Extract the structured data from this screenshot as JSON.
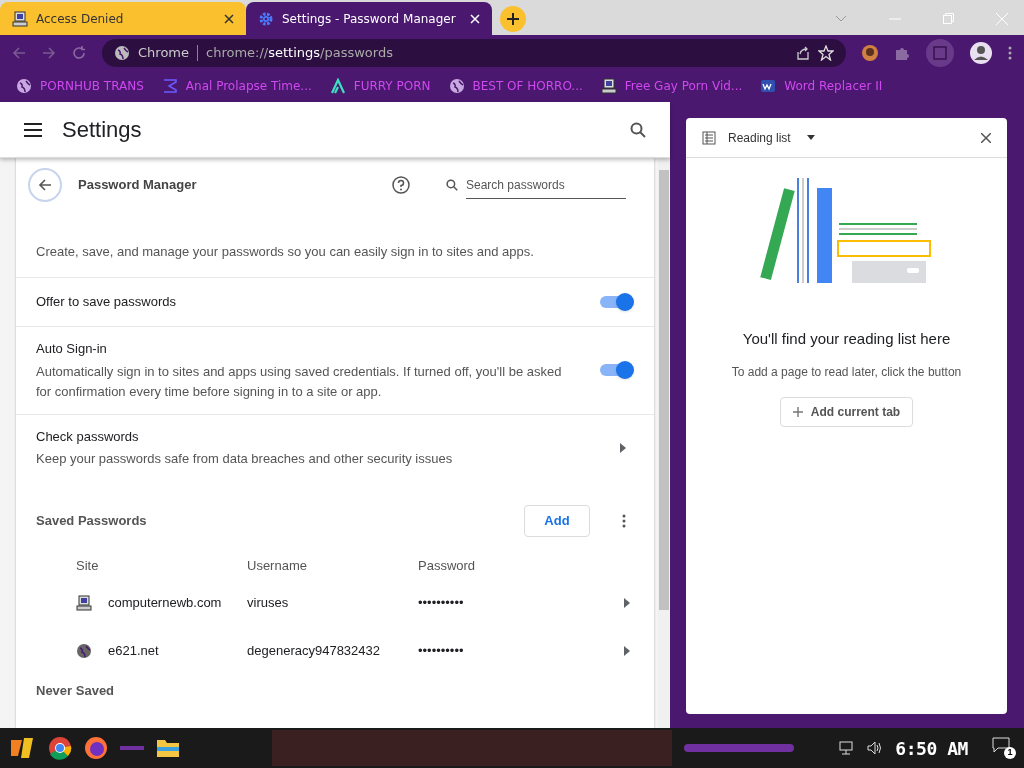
{
  "tabs": [
    {
      "title": "Access Denied",
      "selected": false,
      "kind": "computer"
    },
    {
      "title": "Settings - Password Manager",
      "selected": true,
      "kind": "gear"
    }
  ],
  "omnibox": {
    "chip": "Chrome",
    "url_parts": [
      {
        "text": "chrome://",
        "emphasized": false
      },
      {
        "text": "settings",
        "emphasized": true
      },
      {
        "text": "/passwords",
        "emphasized": false
      }
    ]
  },
  "bookmarks": [
    {
      "label": "PORNHUB TRANS",
      "kind": "globe"
    },
    {
      "label": "Anal Prolapse Time...",
      "kind": "sigma"
    },
    {
      "label": "FURRY PORN",
      "kind": "lambda"
    },
    {
      "label": "BEST OF HORRO...",
      "kind": "globe"
    },
    {
      "label": "Free Gay Porn Vid...",
      "kind": "computer"
    },
    {
      "label": "Word Replacer II",
      "kind": "wr"
    }
  ],
  "settings": {
    "title": "Settings",
    "page_title": "Password Manager",
    "search": {
      "placeholder": "Search passwords"
    },
    "description": "Create, save, and manage your passwords so you can easily sign in to sites and apps.",
    "toggles": [
      {
        "label": "Offer to save passwords",
        "on": true
      },
      {
        "label": "Auto Sign-in",
        "description": "Automatically sign in to sites and apps using saved credentials. If turned off, you'll be asked for confirmation every time before signing in to a site or app.",
        "on": true
      }
    ],
    "check": {
      "title": "Check passwords",
      "description": "Keep your passwords safe from data breaches and other security issues"
    },
    "saved": {
      "title": "Saved Passwords",
      "add_button": "Add",
      "columns": [
        "Site",
        "Username",
        "Password"
      ],
      "rows": [
        {
          "site": "computernewb.com",
          "username": "viruses",
          "password": "••••••••••",
          "kind": "computer"
        },
        {
          "site": "e621.net",
          "username": "degeneracy947832432",
          "password": "••••••••••",
          "kind": "globe"
        }
      ]
    },
    "never_saved": "Never Saved"
  },
  "reading_list": {
    "title": "Reading list",
    "heading": "You'll find your reading list here",
    "text": "To add a page to read later, click the button",
    "button": "Add current tab"
  },
  "taskbar": {
    "time": "6:50 AM",
    "notifications": "1"
  }
}
